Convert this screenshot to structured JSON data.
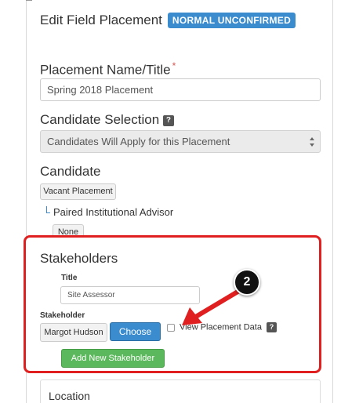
{
  "header": {
    "title": "Edit Field Placement",
    "status": "NORMAL UNCONFIRMED"
  },
  "placement_name": {
    "label": "Placement Name/Title",
    "required": "*",
    "value": "Spring 2018 Placement"
  },
  "candidate_selection": {
    "label": "Candidate Selection",
    "help": "?",
    "selected": "Candidates Will Apply for this Placement"
  },
  "candidate": {
    "label": "Candidate",
    "button": "Vacant Placement"
  },
  "advisor": {
    "label": "Paired Institutional Advisor",
    "button": "None"
  },
  "stakeholders": {
    "heading": "Stakeholders",
    "title_label": "Title",
    "title_value": "Site Assessor",
    "stakeholder_label": "Stakeholder",
    "stakeholder_value": "Margot Hudson",
    "choose": "Choose",
    "view_label": "View Placement Data",
    "view_help": "?",
    "add_button": "Add New Stakeholder"
  },
  "location": {
    "label": "Location"
  },
  "annotation": {
    "step": "2"
  },
  "colors": {
    "accent": "#3a8ccf",
    "annotation": "#e02020",
    "success": "#5cb85c"
  }
}
